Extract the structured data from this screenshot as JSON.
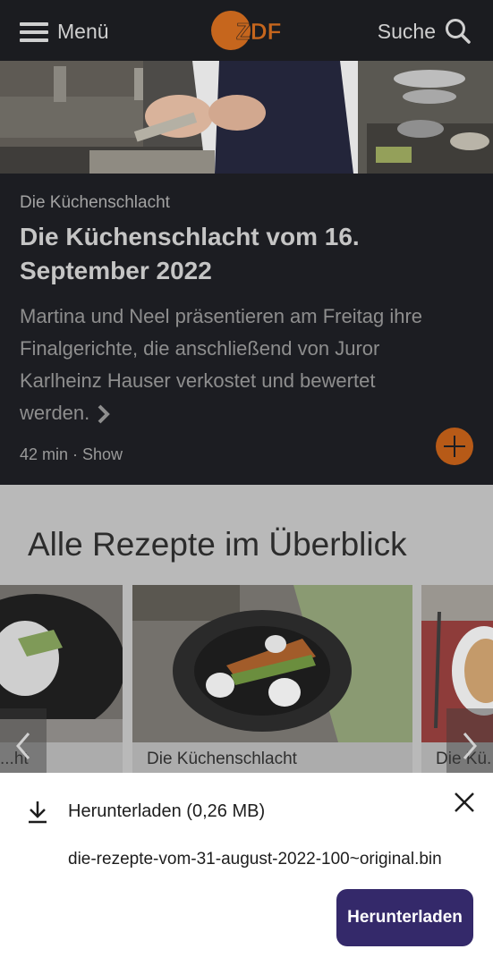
{
  "header": {
    "menu_label": "Menü",
    "logo_text": "ZDF",
    "search_label": "Suche",
    "icons": {
      "menu": "hamburger-icon",
      "search": "search-icon"
    }
  },
  "feature": {
    "category": "Die Küchenschlacht",
    "title": "Die Küchenschlacht vom 16. September 2022",
    "description": "Martina und Neel präsentieren am Freitag ihre Finalgerichte, die anschließend von Juror Karlheinz Hauser verkostet und bewertet werden.",
    "meta": "42 min · Show",
    "accent_color": "#b75a17"
  },
  "recipes": {
    "section_title": "Alle Rezepte im Überblick",
    "tiles": [
      {
        "caption": "...ht"
      },
      {
        "caption": "Die Küchenschlacht"
      },
      {
        "caption": "Die Kü..."
      }
    ]
  },
  "download_sheet": {
    "title": "Herunterladen (0,26 MB)",
    "filename": "die-rezepte-vom-31-august-2022-100~original.bin",
    "button_label": "Herunterladen",
    "button_color": "#34296a",
    "icons": {
      "download": "download-icon",
      "close": "close-icon"
    }
  }
}
